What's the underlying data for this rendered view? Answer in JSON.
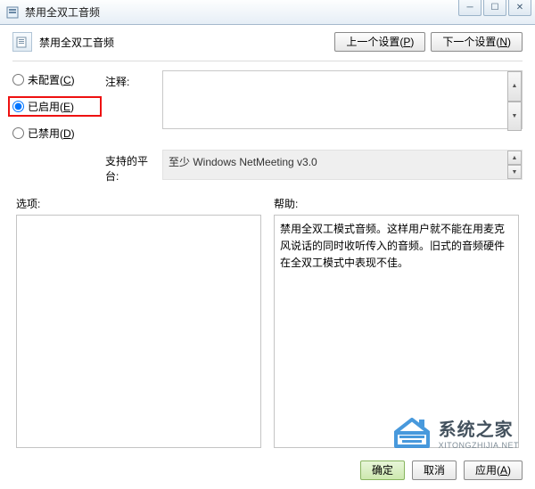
{
  "window": {
    "title": "禁用全双工音频"
  },
  "heading": "禁用全双工音频",
  "nav": {
    "prev": "上一个设置(",
    "prev_key": "P",
    "prev_tail": ")",
    "next": "下一个设置(",
    "next_key": "N",
    "next_tail": ")"
  },
  "radios": {
    "unconfigured": "未配置(",
    "unconfigured_key": "C",
    "unconfigured_tail": ")",
    "enabled": "已启用(",
    "enabled_key": "E",
    "enabled_tail": ")",
    "disabled": "已禁用(",
    "disabled_key": "D",
    "disabled_tail": ")"
  },
  "labels": {
    "comment": "注释:",
    "platform": "支持的平台:",
    "options": "选项:",
    "help": "帮助:"
  },
  "platform_text": "至少 Windows NetMeeting v3.0",
  "help_text": "禁用全双工模式音频。这样用户就不能在用麦克风说话的同时收听传入的音频。旧式的音频硬件在全双工模式中表现不佳。",
  "buttons": {
    "ok": "确定",
    "cancel": "取消",
    "apply": "应用(",
    "apply_key": "A",
    "apply_tail": ")"
  },
  "watermark": {
    "title": "系统之家",
    "sub": "XITONGZHIJIA.NET"
  }
}
